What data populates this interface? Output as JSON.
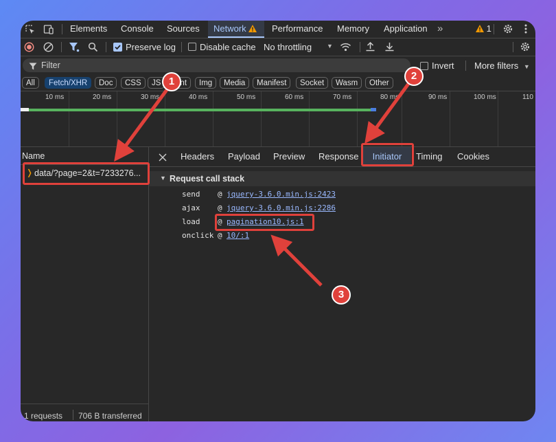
{
  "main_tabs": [
    "Elements",
    "Console",
    "Sources",
    "Network",
    "Performance",
    "Memory",
    "Application"
  ],
  "more_tabs_icon": "double-chevron-icon",
  "warning_count": "1",
  "toolbar": {
    "preserve_log": "Preserve log",
    "disable_cache": "Disable cache",
    "throttling": "No throttling"
  },
  "filter": {
    "placeholder": "Filter",
    "invert": "Invert",
    "more_filters": "More filters"
  },
  "type_filters": [
    "All",
    "Fetch/XHR",
    "Doc",
    "CSS",
    "JS",
    "Font",
    "Img",
    "Media",
    "Manifest",
    "Socket",
    "Wasm",
    "Other"
  ],
  "timeline_ticks": [
    "10 ms",
    "20 ms",
    "30 ms",
    "40 ms",
    "50 ms",
    "60 ms",
    "70 ms",
    "80 ms",
    "90 ms",
    "100 ms",
    "110"
  ],
  "request_list": {
    "header": "Name",
    "items": [
      "data/?page=2&t=7233276..."
    ]
  },
  "detail_tabs": [
    "Headers",
    "Payload",
    "Preview",
    "Response",
    "Initiator",
    "Timing",
    "Cookies"
  ],
  "section_title": "Request call stack",
  "call_stack": [
    {
      "fn": "send",
      "at": "@",
      "src": "jquery-3.6.0.min.js:2423"
    },
    {
      "fn": "ajax",
      "at": "@",
      "src": "jquery-3.6.0.min.js:2286"
    },
    {
      "fn": "load",
      "at": "@",
      "src": "pagination10.js:1"
    },
    {
      "fn": "onclick",
      "at": "@",
      "src": "10/:1"
    }
  ],
  "status": {
    "requests": "1 requests",
    "transferred": "706 B transferred"
  },
  "annotations": [
    "1",
    "2",
    "3"
  ],
  "colors": {
    "accent_tab": "#a8c7fa",
    "annotation_red": "#e0413b",
    "active_chip": "#17416e",
    "link": "#9ab9ff",
    "timeline_bar": "#58b35e"
  }
}
